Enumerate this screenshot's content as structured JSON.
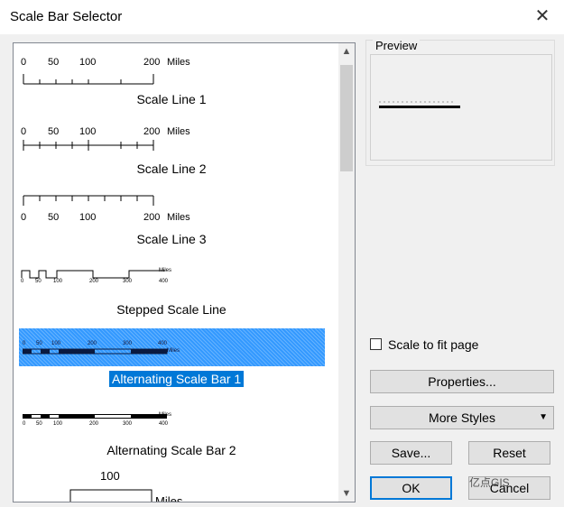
{
  "window": {
    "title": "Scale Bar Selector",
    "close_glyph": "✕"
  },
  "styles": [
    {
      "label": "Scale Line 1",
      "ticks": [
        "0",
        "50",
        "100",
        "200"
      ],
      "unit": "Miles"
    },
    {
      "label": "Scale Line 2",
      "ticks": [
        "0",
        "50",
        "100",
        "200"
      ],
      "unit": "Miles"
    },
    {
      "label": "Scale Line 3",
      "ticks": [
        "0",
        "50",
        "100",
        "200"
      ],
      "unit": "Miles"
    },
    {
      "label": "Stepped Scale Line",
      "ticks": [
        "0",
        "50",
        "100",
        "200",
        "300",
        "400"
      ],
      "unit": "Miles"
    },
    {
      "label": "Alternating Scale Bar 1",
      "ticks": [
        "0",
        "50",
        "100",
        "200",
        "300",
        "400"
      ],
      "unit": "Miles",
      "selected": true
    },
    {
      "label": "Alternating Scale Bar 2",
      "ticks": [
        "0",
        "50",
        "100",
        "200",
        "300",
        "400"
      ],
      "unit": "Miles"
    },
    {
      "label": "",
      "ticks": [
        "100"
      ],
      "unit": "Miles"
    }
  ],
  "preview": {
    "title": "Preview"
  },
  "scale_to_fit": {
    "label": "Scale to fit page",
    "checked": false
  },
  "buttons": {
    "properties": "Properties...",
    "more_styles": "More Styles",
    "save": "Save...",
    "reset": "Reset",
    "ok": "OK",
    "cancel": "Cancel"
  },
  "watermark": "亿点GIS",
  "colors": {
    "selection": "#0078d7",
    "accent": "#0078d7"
  }
}
